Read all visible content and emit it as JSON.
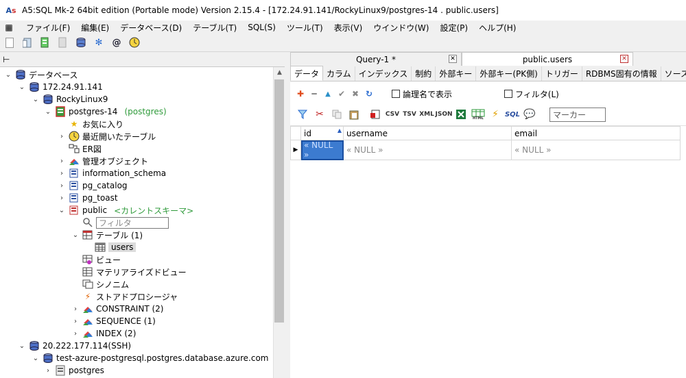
{
  "window": {
    "title": "A5:SQL Mk-2 64bit edition (Portable mode) Version 2.15.4 - [172.24.91.141/RockyLinux9/postgres-14 . public.users]"
  },
  "menu": [
    {
      "label": "ファイル(F)"
    },
    {
      "label": "編集(E)"
    },
    {
      "label": "データベース(D)"
    },
    {
      "label": "テーブル(T)"
    },
    {
      "label": "SQL(S)"
    },
    {
      "label": "ツール(T)"
    },
    {
      "label": "表示(V)"
    },
    {
      "label": "ウインドウ(W)"
    },
    {
      "label": "設定(P)"
    },
    {
      "label": "ヘルプ(H)"
    }
  ],
  "tree": {
    "root": "データベース",
    "host1": "172.24.91.141",
    "server1": "RockyLinux9",
    "db1": "postgres-14",
    "db1_note": "(postgres)",
    "favorites": "お気に入り",
    "recent": "最近開いたテーブル",
    "er": "ER図",
    "admin": "管理オブジェクト",
    "info_schema": "information_schema",
    "pg_catalog": "pg_catalog",
    "pg_toast": "pg_toast",
    "public": "public",
    "public_note": "<カレントスキーマ>",
    "filter_placeholder": "フィルタ",
    "tables": "テーブル (1)",
    "users": "users",
    "views": "ビュー",
    "mviews": "マテリアライズドビュー",
    "synonyms": "シノニム",
    "procs": "ストアドプロシージャ",
    "constraint": "CONSTRAINT (2)",
    "sequence": "SEQUENCE (1)",
    "index": "INDEX (2)",
    "host2": "20.222.177.114(SSH)",
    "server2": "test-azure-postgresql.postgres.database.azure.com",
    "db2": "postgres"
  },
  "doc_tabs": [
    {
      "label": "Query-1 *"
    },
    {
      "label": "public.users"
    }
  ],
  "sub_tabs": [
    {
      "label": "データ"
    },
    {
      "label": "カラム"
    },
    {
      "label": "インデックス"
    },
    {
      "label": "制約"
    },
    {
      "label": "外部キー"
    },
    {
      "label": "外部キー(PK側)"
    },
    {
      "label": "トリガー"
    },
    {
      "label": "RDBMS固有の情報"
    },
    {
      "label": "ソース"
    }
  ],
  "options": {
    "logical_name": "論理名で表示",
    "filter": "フィルタ(L)",
    "marker_placeholder": "マーカー"
  },
  "grid": {
    "columns": [
      "id",
      "username",
      "email"
    ],
    "row": [
      "« NULL »",
      "« NULL »",
      "« NULL »"
    ]
  }
}
